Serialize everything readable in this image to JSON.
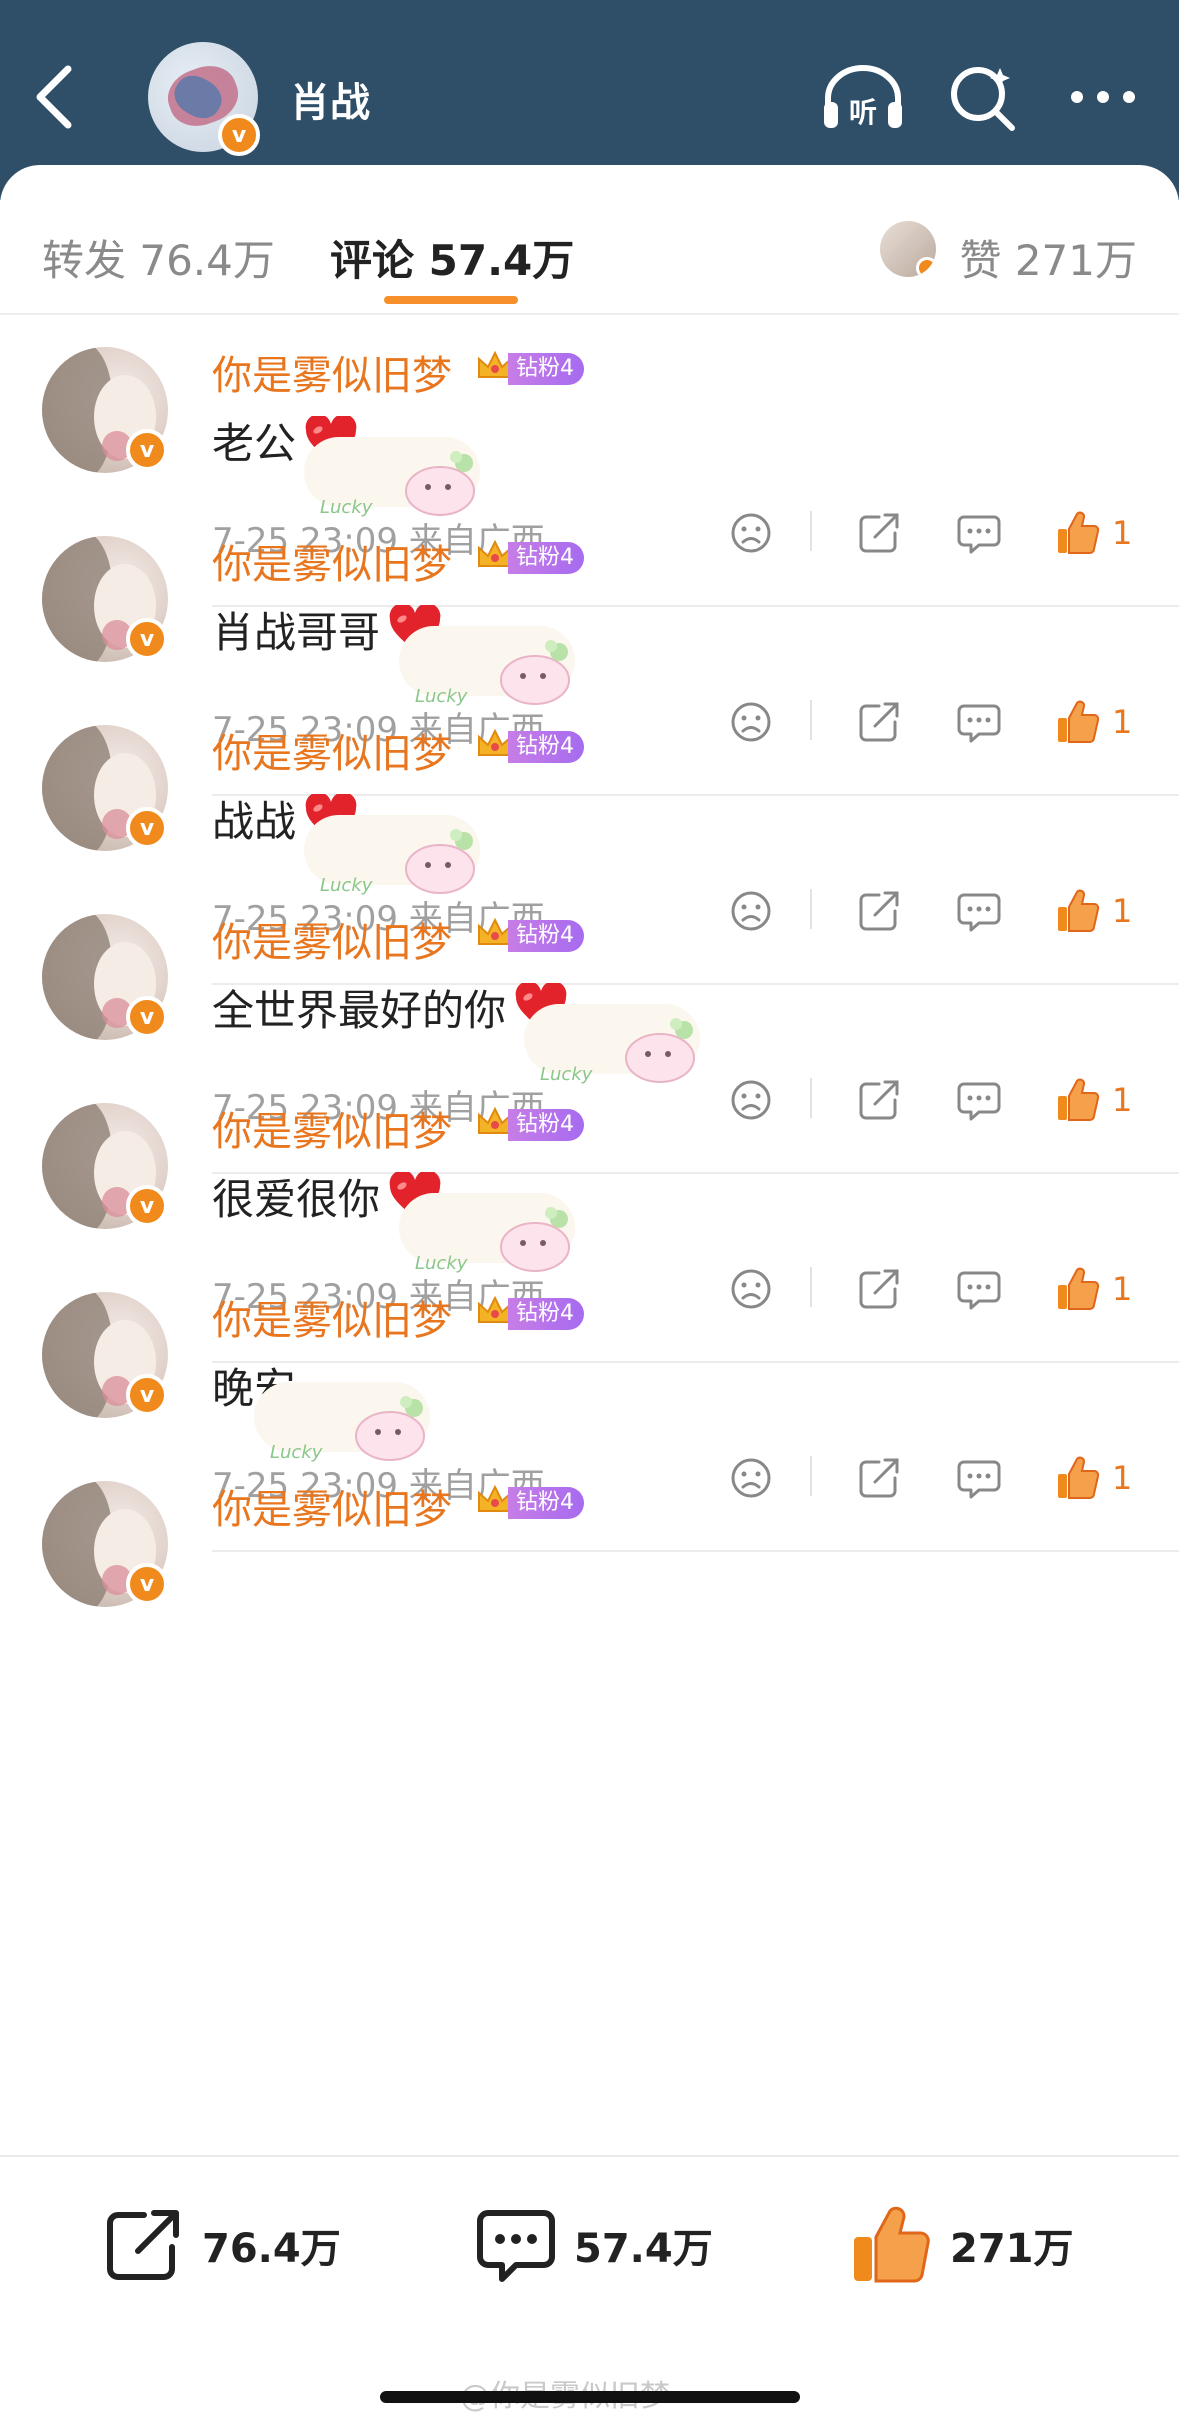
{
  "header": {
    "title": "肖战",
    "listen_label": "听"
  },
  "tabs": {
    "repost": "转发 76.4万",
    "comment": "评论 57.4万",
    "likes": "赞 271万"
  },
  "comments": [
    {
      "name": "你是雾似旧梦",
      "badge": "钻粉4",
      "text": "老公",
      "heart": true,
      "meta": "7-25 23:09 来自广西",
      "likes": "1"
    },
    {
      "name": "你是雾似旧梦",
      "badge": "钻粉4",
      "text": "肖战哥哥",
      "heart": true,
      "meta": "7-25 23:09 来自广西",
      "likes": "1"
    },
    {
      "name": "你是雾似旧梦",
      "badge": "钻粉4",
      "text": "战战",
      "heart": true,
      "meta": "7-25 23:09 来自广西",
      "likes": "1"
    },
    {
      "name": "你是雾似旧梦",
      "badge": "钻粉4",
      "text": "全世界最好的你",
      "heart": true,
      "meta": "7-25 23:09 来自广西",
      "likes": "1"
    },
    {
      "name": "你是雾似旧梦",
      "badge": "钻粉4",
      "text": "很爱很你",
      "heart": true,
      "meta": "7-25 23:09 来自广西",
      "likes": "1"
    },
    {
      "name": "你是雾似旧梦",
      "badge": "钻粉4",
      "text": "晚安",
      "heart": false,
      "meta": "7-25 23:09 来自广西",
      "likes": "1"
    },
    {
      "name": "你是雾似旧梦",
      "badge": "钻粉4"
    }
  ],
  "bottom": {
    "repost_count": "76.4万",
    "comment_count": "57.4万",
    "like_count": "271万"
  },
  "watermark": "@你是雾似旧梦",
  "colors": {
    "header_bg": "#2f4f68",
    "accent_orange": "#e8761f",
    "tab_underline": "#f7902a",
    "fan_badge": "#b574ec"
  }
}
